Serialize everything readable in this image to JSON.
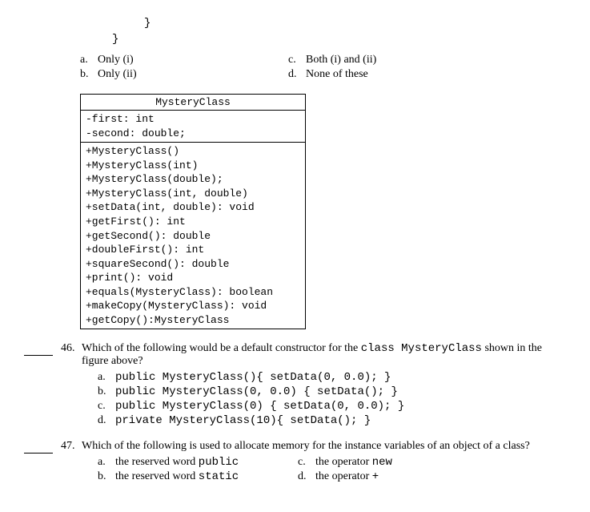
{
  "code_fragment": {
    "line1": "}",
    "line2": "}"
  },
  "top_options": {
    "a": {
      "letter": "a.",
      "text": "Only (i)"
    },
    "b": {
      "letter": "b.",
      "text": "Only (ii)"
    },
    "c": {
      "letter": "c.",
      "text": "Both (i) and (ii)"
    },
    "d": {
      "letter": "d.",
      "text": "None of these"
    }
  },
  "uml": {
    "title": "MysteryClass",
    "attrs": [
      "-first: int",
      "-second: double;"
    ],
    "methods": [
      "+MysteryClass()",
      "+MysteryClass(int)",
      "+MysteryClass(double);",
      "+MysteryClass(int, double)",
      "+setData(int, double): void",
      "+getFirst(): int",
      "+getSecond(): double",
      "+doubleFirst(): int",
      "+squareSecond(): double",
      "+print(): void",
      "+equals(MysteryClass): boolean",
      "+makeCopy(MysteryClass): void",
      "+getCopy():MysteryClass"
    ]
  },
  "q46": {
    "num": "46.",
    "text_pre": "Which of the following would be a default constructor for the ",
    "text_code": "class MysteryClass",
    "text_post": " shown in the figure above?",
    "a": {
      "letter": "a.",
      "code": "public MysteryClass(){ setData(0, 0.0); }"
    },
    "b": {
      "letter": "b.",
      "code": "public MysteryClass(0, 0.0) { setData(); }"
    },
    "c": {
      "letter": "c.",
      "code": "public MysteryClass(0) { setData(0, 0.0); }"
    },
    "d": {
      "letter": "d.",
      "code": "private MysteryClass(10){ setData(); }"
    }
  },
  "q47": {
    "num": "47.",
    "text": "Which of the following is used to allocate memory for the instance variables of an object of a class?",
    "a": {
      "letter": "a.",
      "text_pre": "the reserved word ",
      "text_code": "public"
    },
    "b": {
      "letter": "b.",
      "text_pre": "the reserved word ",
      "text_code": "static"
    },
    "c": {
      "letter": "c.",
      "text_pre": "the operator ",
      "text_code": "new"
    },
    "d": {
      "letter": "d.",
      "text_pre": "the operator ",
      "text_code": "+"
    }
  }
}
